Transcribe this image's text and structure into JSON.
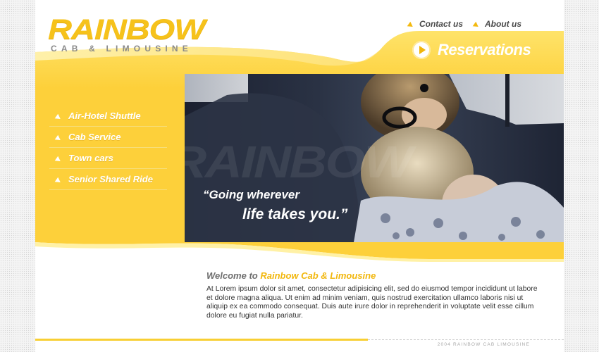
{
  "brand": {
    "logo_main": "RAINBOW",
    "logo_sub": "CAB & LIMOUSINE"
  },
  "topnav": [
    {
      "label": "Contact us"
    },
    {
      "label": "About us"
    }
  ],
  "reservations": {
    "label": "Reservations"
  },
  "menu": [
    {
      "label": "Air-Hotel Shuttle"
    },
    {
      "label": "Cab Service"
    },
    {
      "label": "Town cars"
    },
    {
      "label": "Senior Shared Ride"
    }
  ],
  "hero": {
    "watermark": "RAINBOW",
    "quote_line1": "“Going wherever",
    "quote_line2": "life takes you.”"
  },
  "welcome": {
    "title_prefix": "Welcome to ",
    "title_accent": "Rainbow Cab & Limousine",
    "body": "At Lorem ipsum dolor sit amet, consectetur adipisicing elit, sed do eiusmod tempor incididunt ut labore et dolore magna aliqua. Ut enim ad minim veniam, quis nostrud exercitation ullamco laboris nisi ut aliquip ex ea commodo consequat. Duis aute irure dolor in reprehenderit in voluptate velit esse cillum dolore eu fugiat nulla pariatur."
  },
  "footer": {
    "copyright": "2004 RAINBOW CAB LIMOUSINE"
  },
  "colors": {
    "brand_yellow": "#f6c21b",
    "band_yellow": "#fdd23c",
    "text_grey": "#6e6e6e"
  }
}
